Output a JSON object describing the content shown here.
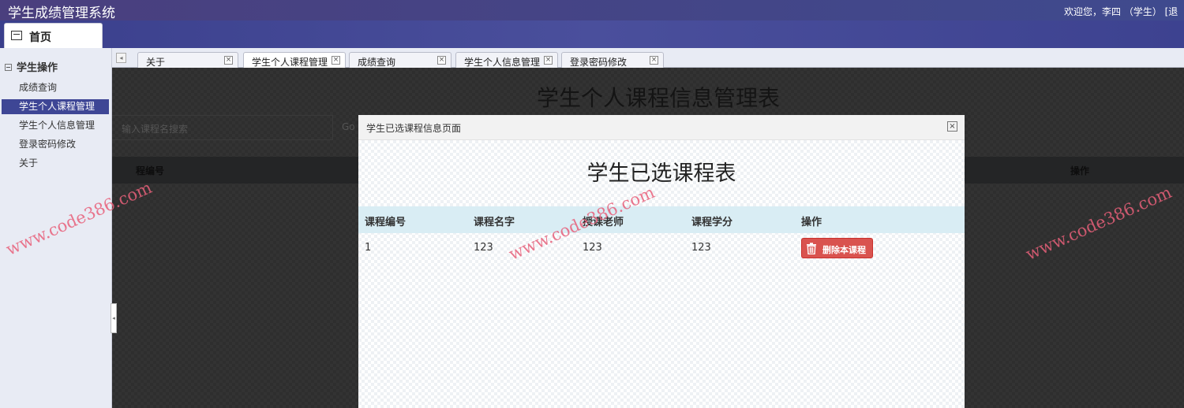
{
  "header": {
    "app_title": "学生成绩管理系统",
    "welcome": "欢迎您，李四 （学生）  [退"
  },
  "home_tab": {
    "label": "首页"
  },
  "sidebar": {
    "section_title": "学生操作",
    "items": [
      {
        "label": "成绩查询",
        "active": false
      },
      {
        "label": "学生个人课程管理",
        "active": true
      },
      {
        "label": "学生个人信息管理",
        "active": false
      },
      {
        "label": "登录密码修改",
        "active": false
      },
      {
        "label": "关于",
        "active": false
      }
    ]
  },
  "tabs": [
    {
      "label": "关于",
      "active": false
    },
    {
      "label": "学生个人课程管理",
      "active": true
    },
    {
      "label": "成绩查询",
      "active": false
    },
    {
      "label": "学生个人信息管理",
      "active": false
    },
    {
      "label": "登录密码修改",
      "active": false
    }
  ],
  "background_page": {
    "heading": "学生个人课程信息管理表",
    "search_placeholder": "输入课程名搜索",
    "go_label": "Go",
    "columns": [
      "程编号",
      "操作"
    ]
  },
  "modal": {
    "title": "学生已选课程信息页面",
    "heading": "学生已选课程表",
    "columns": [
      "课程编号",
      "课程名字",
      "授课老师",
      "课程学分",
      "操作"
    ],
    "rows": [
      {
        "id": "1",
        "name": "123",
        "teacher": "123",
        "credit": "123",
        "action_label": "删除本课程"
      }
    ]
  },
  "watermark": "www.code386.com",
  "colors": {
    "header": "#3e4695",
    "active_item": "#3e4695",
    "delete_button": "#d9534f",
    "table_header": "#d9edf4",
    "watermark": "#e8607a"
  }
}
